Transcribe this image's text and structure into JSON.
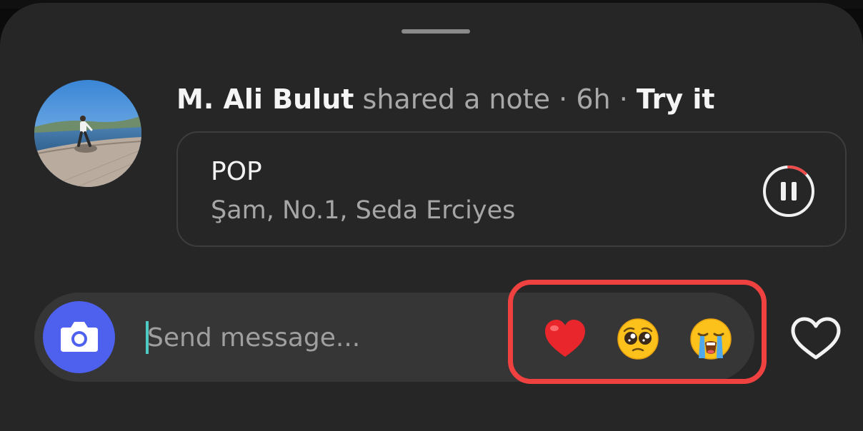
{
  "note": {
    "author": "M. Ali Bulut",
    "action": "shared a note",
    "separator": "·",
    "time": "6h",
    "try_label": "Try it",
    "song": {
      "title": "POP",
      "subtitle": "Şam, No.1, Seda Erciyes",
      "playback_progress": 0.12
    }
  },
  "composer": {
    "placeholder": "Send message...",
    "value": ""
  },
  "reactions": [
    {
      "icon": "red-heart-emoji"
    },
    {
      "icon": "pleading-face-emoji"
    },
    {
      "icon": "crying-face-emoji"
    }
  ],
  "colors": {
    "sheet_background": "#262626",
    "camera_button": "#4e61ee",
    "highlight": "#ef4140",
    "progress_ring": "#ef4b4b"
  }
}
